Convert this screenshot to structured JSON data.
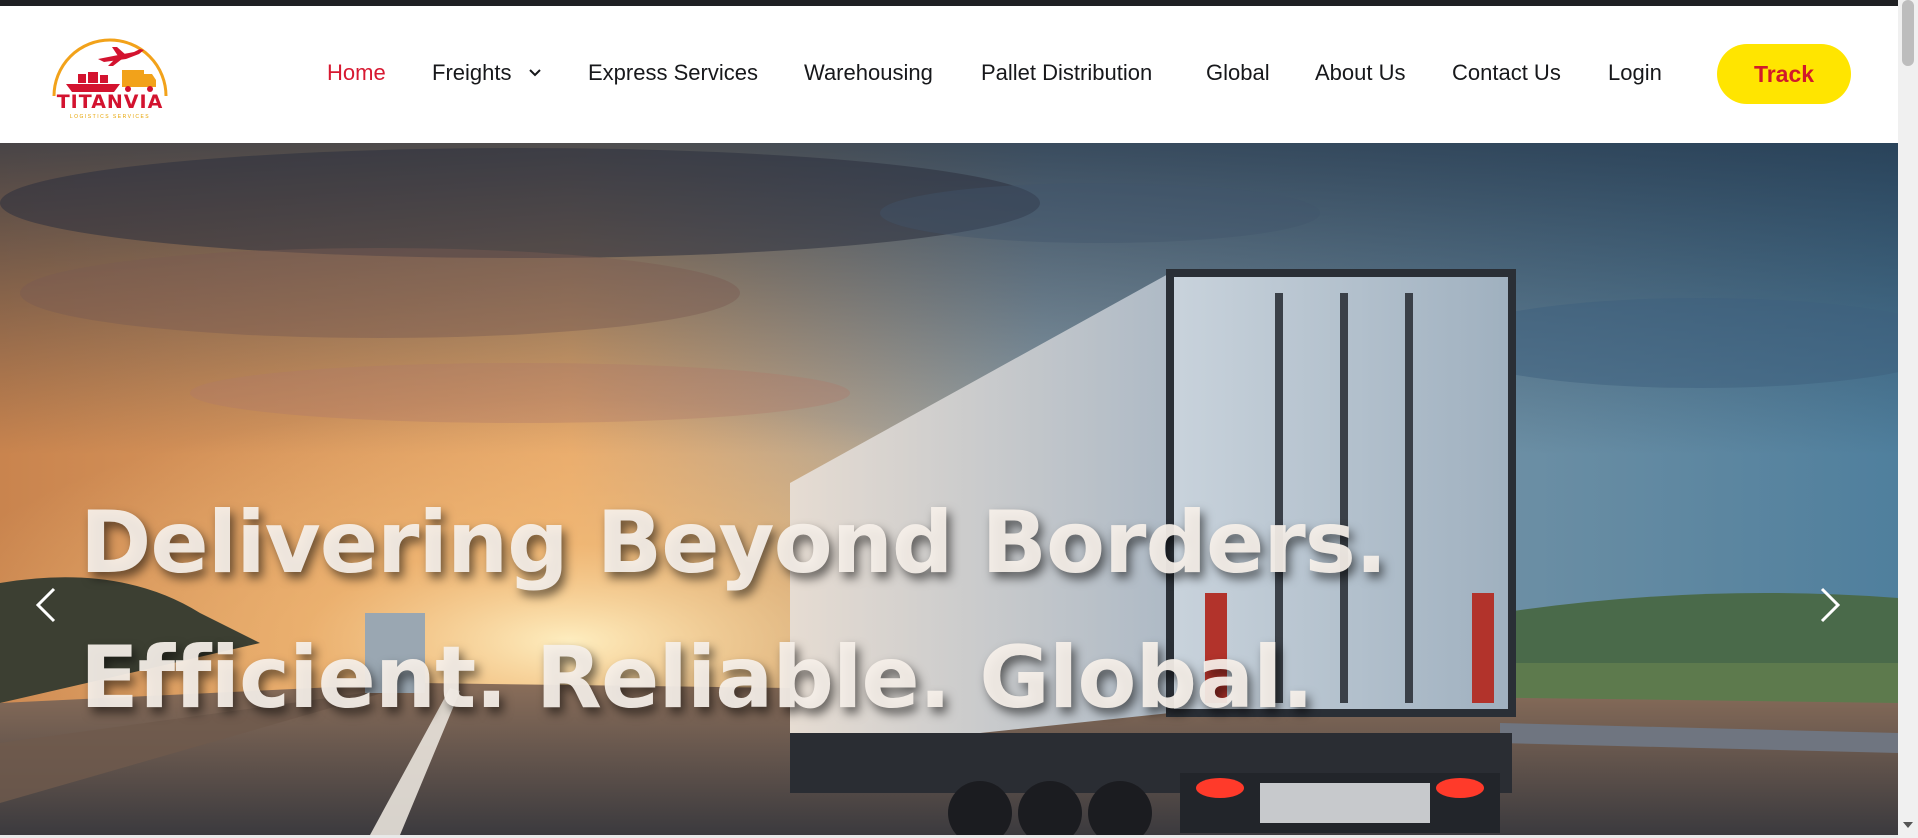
{
  "brand": {
    "name": "TITANVIA",
    "tagline": "LOGISTICS SERVICES",
    "colors": {
      "red": "#d3132f",
      "yellow": "#ffe500",
      "orange": "#f2a21a"
    }
  },
  "nav": {
    "items": [
      {
        "label": "Home",
        "active": true
      },
      {
        "label": "Freights",
        "has_dropdown": true
      },
      {
        "label": "Express Services"
      },
      {
        "label": "Warehousing"
      },
      {
        "label": "Pallet Distribution"
      },
      {
        "label": "Global"
      },
      {
        "label": "About Us"
      },
      {
        "label": "Contact Us"
      },
      {
        "label": "Login"
      }
    ],
    "track_label": "Track",
    "active_color": "#d71931"
  },
  "hero": {
    "headline_1": "Delivering Beyond Borders.",
    "headline_2": "Efficient. Reliable. Global.",
    "prev_icon": "chevron-left-icon",
    "next_icon": "chevron-right-icon"
  },
  "icons": {
    "dropdown": "chevron-down-icon",
    "logo_plane": "airplane-icon",
    "logo_ship": "ship-icon",
    "logo_truck": "truck-icon"
  }
}
